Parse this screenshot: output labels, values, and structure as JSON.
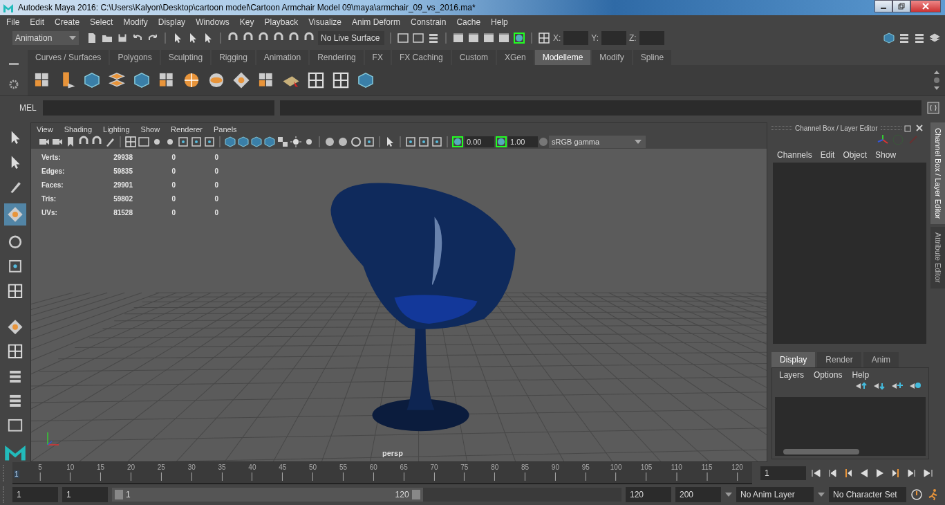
{
  "window": {
    "title": "Autodesk Maya 2016: C:\\Users\\Kalyon\\Desktop\\cartoon model\\Cartoon Armchair Model 09\\maya\\armchair_09_vs_2016.ma*"
  },
  "menu": [
    "File",
    "Edit",
    "Create",
    "Select",
    "Modify",
    "Display",
    "Windows",
    "Key",
    "Playback",
    "Visualize",
    "Anim Deform",
    "Constrain",
    "Cache",
    "Help"
  ],
  "status_line": {
    "mode": "Animation",
    "live_surface": "No Live Surface",
    "x_label": "X:",
    "y_label": "Y:",
    "z_label": "Z:"
  },
  "shelf": {
    "tabs": [
      {
        "label": "Curves / Surfaces",
        "selected": false
      },
      {
        "label": "Polygons",
        "selected": false
      },
      {
        "label": "Sculpting",
        "selected": false
      },
      {
        "label": "Rigging",
        "selected": false
      },
      {
        "label": "Animation",
        "selected": false
      },
      {
        "label": "Rendering",
        "selected": false
      },
      {
        "label": "FX",
        "selected": false
      },
      {
        "label": "FX Caching",
        "selected": false
      },
      {
        "label": "Custom",
        "selected": false
      },
      {
        "label": "XGen",
        "selected": false
      },
      {
        "label": "Modelleme",
        "selected": true
      },
      {
        "label": "Modify",
        "selected": false
      },
      {
        "label": "Spline",
        "selected": false
      }
    ]
  },
  "command_line": {
    "language": "MEL"
  },
  "viewport": {
    "menu": [
      "View",
      "Shading",
      "Lighting",
      "Show",
      "Renderer",
      "Panels"
    ],
    "exposure": "0.00",
    "gamma": "1.00",
    "color_space": "sRGB gamma",
    "hud": [
      {
        "label": "Verts:",
        "values": [
          "29938",
          "0",
          "0"
        ]
      },
      {
        "label": "Edges:",
        "values": [
          "59835",
          "0",
          "0"
        ]
      },
      {
        "label": "Faces:",
        "values": [
          "29901",
          "0",
          "0"
        ]
      },
      {
        "label": "Tris:",
        "values": [
          "59802",
          "0",
          "0"
        ]
      },
      {
        "label": "UVs:",
        "values": [
          "81528",
          "0",
          "0"
        ]
      }
    ],
    "camera": "persp"
  },
  "channel_box": {
    "title": "Channel Box / Layer Editor",
    "menu": [
      "Channels",
      "Edit",
      "Object",
      "Show"
    ],
    "layer_tabs": [
      {
        "label": "Display",
        "selected": true
      },
      {
        "label": "Render",
        "selected": false
      },
      {
        "label": "Anim",
        "selected": false
      }
    ],
    "layer_menu": [
      "Layers",
      "Options",
      "Help"
    ]
  },
  "side_tabs": [
    {
      "label": "Channel Box / Layer Editor",
      "selected": true
    },
    {
      "label": "Attribute Editor",
      "selected": false
    }
  ],
  "timeline": {
    "start_label": "1",
    "ticks": [
      "5",
      "10",
      "15",
      "20",
      "25",
      "30",
      "35",
      "40",
      "45",
      "50",
      "55",
      "60",
      "65",
      "70",
      "75",
      "80",
      "85",
      "90",
      "95",
      "100",
      "105",
      "110",
      "115",
      "120"
    ],
    "current_frame": "1",
    "level": 0
  },
  "range": {
    "start": "1",
    "playback_start": "1",
    "slider_start": "1",
    "slider_end": "120",
    "level": 0.61,
    "playback_end": "120",
    "end": "200",
    "anim_layer": "No Anim Layer",
    "character_set": "No Character Set"
  }
}
